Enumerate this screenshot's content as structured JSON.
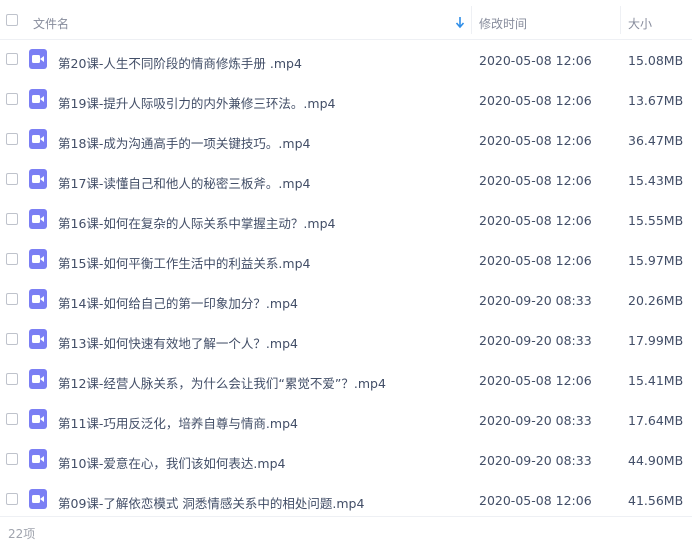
{
  "header": {
    "name_label": "文件名",
    "modified_label": "修改时间",
    "size_label": "大小"
  },
  "icon_names": {
    "file": "video-file-icon",
    "sort": "sort-down-arrow-icon"
  },
  "colors": {
    "icon": "#7b7ff4",
    "sort_arrow": "#2f8ee8",
    "text": "#424e67"
  },
  "files": [
    {
      "name": "第20课-人生不同阶段的情商修炼手册 .mp4",
      "modified": "2020-05-08 12:06",
      "size": "15.08MB"
    },
    {
      "name": "第19课-提升人际吸引力的内外兼修三环法。.mp4",
      "modified": "2020-05-08 12:06",
      "size": "13.67MB"
    },
    {
      "name": "第18课-成为沟通高手的一项关键技巧。.mp4",
      "modified": "2020-05-08 12:06",
      "size": "36.47MB"
    },
    {
      "name": "第17课-读懂自己和他人的秘密三板斧。.mp4",
      "modified": "2020-05-08 12:06",
      "size": "15.43MB"
    },
    {
      "name": "第16课-如何在复杂的人际关系中掌握主动？.mp4",
      "modified": "2020-05-08 12:06",
      "size": "15.55MB"
    },
    {
      "name": "第15课-如何平衡工作生活中的利益关系.mp4",
      "modified": "2020-05-08 12:06",
      "size": "15.97MB"
    },
    {
      "name": "第14课-如何给自己的第一印象加分？.mp4",
      "modified": "2020-09-20 08:33",
      "size": "20.26MB"
    },
    {
      "name": "第13课-如何快速有效地了解一个人？.mp4",
      "modified": "2020-09-20 08:33",
      "size": "17.99MB"
    },
    {
      "name": "第12课-经营人脉关系，为什么会让我们“累觉不爱”？.mp4",
      "modified": "2020-05-08 12:06",
      "size": "15.41MB"
    },
    {
      "name": "第11课-巧用反泛化，培养自尊与情商.mp4",
      "modified": "2020-09-20 08:33",
      "size": "17.64MB"
    },
    {
      "name": "第10课-爱意在心，我们该如何表达.mp4",
      "modified": "2020-09-20 08:33",
      "size": "44.90MB"
    },
    {
      "name": "第09课-了解依恋模式 洞悉情感关系中的相处问题.mp4",
      "modified": "2020-05-08 12:06",
      "size": "41.56MB"
    }
  ],
  "footer": {
    "count": "22项"
  }
}
